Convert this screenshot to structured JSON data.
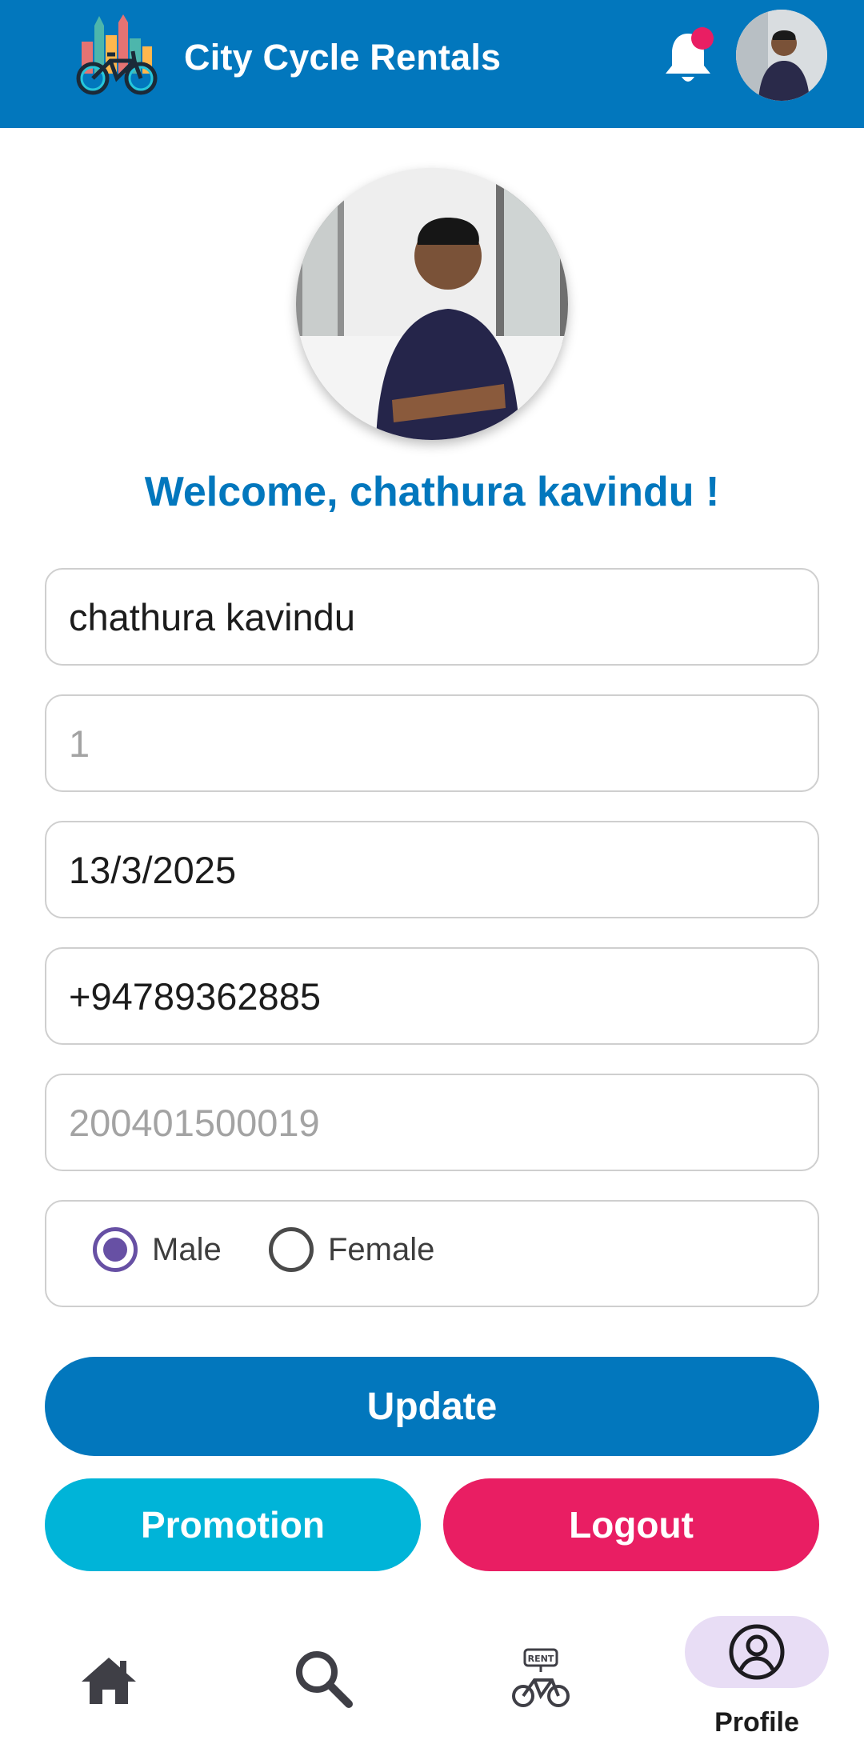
{
  "header": {
    "title": "City Cycle Rentals",
    "logo_icon": "city-bicycle-logo-icon",
    "notification_icon": "bell-icon",
    "has_unread_notification": true,
    "avatar": "user-avatar"
  },
  "profile": {
    "photo": "profile-photo",
    "welcome_text": "Welcome, chathura kavindu !"
  },
  "form": {
    "name_value": "chathura kavindu",
    "field2_placeholder": "1",
    "date_value": "13/3/2025",
    "phone_value": "+94789362885",
    "nic_placeholder": "200401500019",
    "gender": {
      "options": [
        "Male",
        "Female"
      ],
      "selected": "Male"
    }
  },
  "buttons": {
    "update": "Update",
    "promotion": "Promotion",
    "logout": "Logout"
  },
  "bottom_nav": {
    "items": [
      {
        "icon": "home-icon",
        "label": ""
      },
      {
        "icon": "search-icon",
        "label": ""
      },
      {
        "icon": "rent-bicycle-icon",
        "label": ""
      },
      {
        "icon": "profile-icon",
        "label": "Profile"
      }
    ],
    "active": "Profile",
    "rent_badge_text": "RENT"
  },
  "colors": {
    "primary": "#0277bd",
    "promotion": "#00b4d8",
    "logout": "#e91e63",
    "radio_selected": "#6750a4",
    "nav_active_bg": "#e8ddf5"
  }
}
